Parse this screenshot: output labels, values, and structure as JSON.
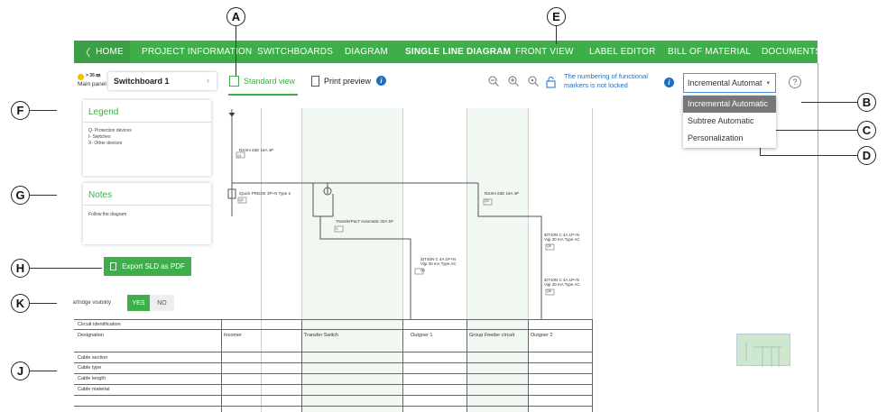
{
  "nav": {
    "home": "HOME",
    "items": [
      "PROJECT INFORMATION",
      "SWITCHBOARDS",
      "DIAGRAM",
      "SINGLE LINE DIAGRAM",
      "FRONT VIEW",
      "LABEL EDITOR",
      "BILL OF MATERIAL",
      "DOCUMENTS"
    ],
    "active": "SINGLE LINE DIAGRAM"
  },
  "callouts": [
    "A",
    "B",
    "C",
    "D",
    "E",
    "F",
    "G",
    "H",
    "J",
    "K"
  ],
  "board": {
    "size": "> 36 ㎜",
    "panel": "Main panel",
    "name": "Switchboard 1"
  },
  "toolbar": {
    "standard_view": "Standard view",
    "print_preview": "Print preview",
    "numbering_note_1": "The numbering of functional",
    "numbering_note_2": "markers is not locked",
    "select_value": "Incremental Automat",
    "dropdown_options": [
      "Incremental Automatic",
      "Subtree Automatic",
      "Personalization"
    ],
    "help": "?"
  },
  "legend": {
    "title": "Legend",
    "lines": [
      "Q- Protection devices",
      "I- Switches",
      "X- Other devices"
    ]
  },
  "notes": {
    "title": "Notes",
    "text": "Follow the diagram"
  },
  "export_button": "Export SLD as PDF",
  "cartridge": {
    "label": "Cartridge visibility",
    "yes": "YES",
    "no": "NO"
  },
  "diagram": {
    "labels": {
      "nsx_main": "NSXm 63E 16A 4P",
      "q1": "Q1",
      "iquick": "iQuick PRD20r 3P+N Type 2",
      "q2": "Q2",
      "transfer": "TransferPacT Automatic 32A 4P",
      "i1": "I1",
      "nsx_group": "NSXm 63E 16A 4P",
      "q4": "Q4",
      "idt_a": "iDT40N C 4A 1P+N",
      "idt_a2": "Vigi 30 mA Type AC",
      "q3": "Q3",
      "idt_b": "iDT40N C 4A 1P+N",
      "idt_b2": "Vigi 30 mA Type AC",
      "q5": "Q5",
      "idt_c": "iDT40N C 4A 1P+N",
      "idt_c2": "Vigi 30 mA Type AC",
      "q6": "Q6"
    }
  },
  "table": {
    "rows": [
      "Circuit identification",
      "Designation",
      "Cable section",
      "Cable type",
      "Cable length",
      "Cable material"
    ],
    "columns": [
      "Incomer",
      "Transfer Switch",
      "Outgoer 1",
      "Group Feeder circuit",
      "Outgoer 2"
    ]
  }
}
